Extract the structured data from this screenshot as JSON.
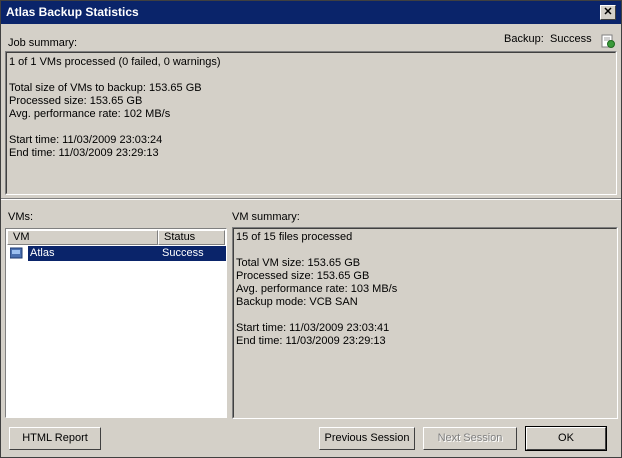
{
  "window": {
    "title": "Atlas Backup Statistics"
  },
  "job": {
    "label": "Job summary:",
    "backup_label": "Backup:",
    "backup_status": "Success",
    "lines": [
      "1 of 1 VMs processed (0 failed, 0 warnings)",
      "",
      "Total size of VMs to backup: 153.65 GB",
      "Processed size: 153.65 GB",
      "Avg. performance rate: 102 MB/s",
      "",
      "Start time: 11/03/2009 23:03:24",
      "End time: 11/03/2009 23:29:13"
    ]
  },
  "vms": {
    "label": "VMs:",
    "columns": [
      "VM",
      "Status"
    ],
    "rows": [
      {
        "name": "Atlas",
        "status": "Success"
      }
    ]
  },
  "vm_summary": {
    "label": "VM summary:",
    "lines": [
      "15 of 15 files processed",
      "",
      "Total VM size: 153.65 GB",
      "Processed size: 153.65 GB",
      "Avg. performance rate: 103 MB/s",
      "Backup mode: VCB SAN",
      "",
      "Start time: 11/03/2009 23:03:41",
      "End time: 11/03/2009 23:29:13"
    ]
  },
  "buttons": {
    "html_report": "HTML Report",
    "previous_session": "Previous Session",
    "next_session": "Next Session",
    "ok": "OK"
  }
}
